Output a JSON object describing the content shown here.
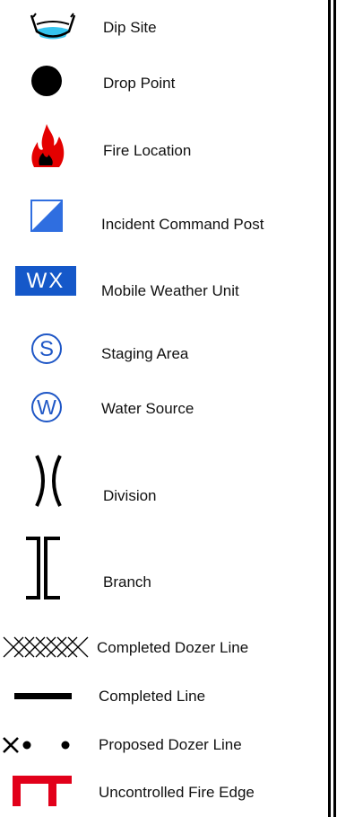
{
  "legend": {
    "items": [
      {
        "label": "Dip Site",
        "icon": "dip-site-icon"
      },
      {
        "label": "Drop Point",
        "icon": "drop-point-icon"
      },
      {
        "label": "Fire Location",
        "icon": "fire-location-icon"
      },
      {
        "label": "Incident Command Post",
        "icon": "incident-command-post-icon"
      },
      {
        "label": "Mobile Weather Unit",
        "icon": "mobile-weather-unit-icon",
        "icon_text": "WX"
      },
      {
        "label": "Staging Area",
        "icon": "staging-area-icon",
        "icon_text": "S"
      },
      {
        "label": "Water Source",
        "icon": "water-source-icon",
        "icon_text": "W"
      },
      {
        "label": "Division",
        "icon": "division-icon"
      },
      {
        "label": "Branch",
        "icon": "branch-icon"
      },
      {
        "label": "Completed Dozer Line",
        "icon": "completed-dozer-line-icon"
      },
      {
        "label": "Completed Line",
        "icon": "completed-line-icon"
      },
      {
        "label": "Proposed Dozer Line",
        "icon": "proposed-dozer-line-icon"
      },
      {
        "label": "Uncontrolled Fire Edge",
        "icon": "uncontrolled-fire-edge-icon"
      }
    ]
  },
  "colors": {
    "dip_water": "#35c4ee",
    "fire_red": "#e40000",
    "icp_blue": "#2f6ee0",
    "wx_blue": "#1558c9",
    "circle_blue": "#1f57c6",
    "edge_red": "#e2001a"
  }
}
